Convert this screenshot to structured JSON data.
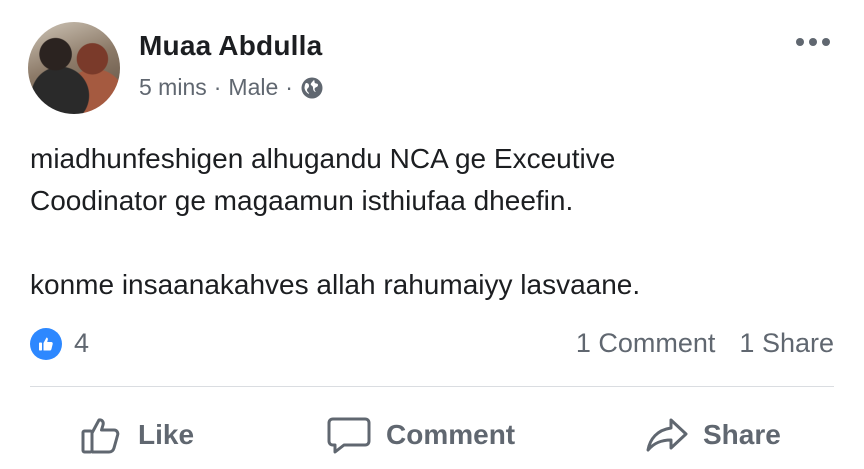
{
  "post": {
    "author_name": "Muaa Abdulla",
    "time": "5 mins",
    "separator": "·",
    "location": "Male",
    "audience_icon": "globe-icon",
    "content_lines": [
      "miadhunfeshigen alhugandu NCA ge Exceutive",
      "Coodinator ge magaamun isthiufaa dheefin.",
      "konme insaanakahves allah rahumaiyy lasvaane."
    ]
  },
  "stats": {
    "like_count": "4",
    "comments": "1 Comment",
    "shares": "1 Share"
  },
  "actions": {
    "like_label": "Like",
    "comment_label": "Comment",
    "share_label": "Share"
  },
  "colors": {
    "like_blue": "#2d88ff",
    "secondary_text": "#606770",
    "primary_text": "#1c1e21"
  }
}
